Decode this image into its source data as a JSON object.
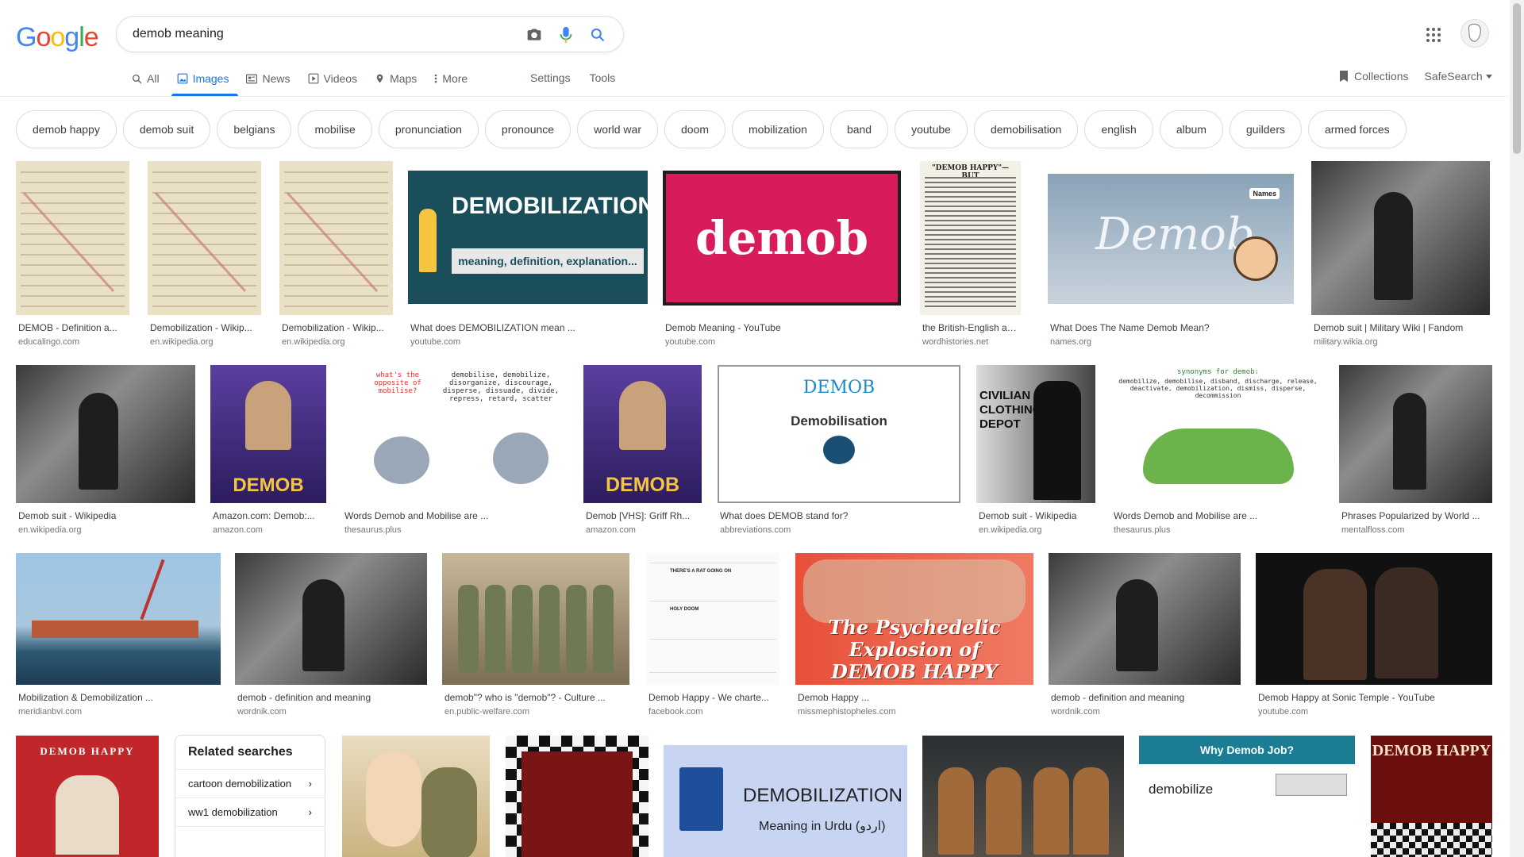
{
  "logo": {
    "letters": [
      "G",
      "o",
      "o",
      "g",
      "l",
      "e"
    ],
    "colors": [
      "#4285f4",
      "#ea4335",
      "#fbbc05",
      "#4285f4",
      "#34a853",
      "#ea4335"
    ]
  },
  "search": {
    "query": "demob meaning"
  },
  "tabs": [
    {
      "label": "All",
      "icon": "search-icon"
    },
    {
      "label": "Images",
      "icon": "image-icon",
      "active": true
    },
    {
      "label": "News",
      "icon": "news-icon"
    },
    {
      "label": "Videos",
      "icon": "video-icon"
    },
    {
      "label": "Maps",
      "icon": "map-icon"
    },
    {
      "label": "More",
      "icon": "more-vert-icon"
    }
  ],
  "tools": {
    "settings": "Settings",
    "tools": "Tools"
  },
  "right_tools": {
    "collections": "Collections",
    "safesearch": "SafeSearch"
  },
  "chips": [
    "demob happy",
    "demob suit",
    "belgians",
    "mobilise",
    "pronunciation",
    "pronounce",
    "world war",
    "doom",
    "mobilization",
    "band",
    "youtube",
    "demobilisation",
    "english",
    "album",
    "guilders",
    "armed forces"
  ],
  "results": [
    {
      "title": "DEMOB - Definition a...",
      "source": "educalingo.com"
    },
    {
      "title": "Demobilization - Wikip...",
      "source": "en.wikipedia.org"
    },
    {
      "title": "Demobilization - Wikip...",
      "source": "en.wikipedia.org"
    },
    {
      "title": "What does DEMOBILIZATION mean ...",
      "source": "youtube.com",
      "overlay": "DEMOBILIZATION",
      "sub": "meaning, definition, explanation..."
    },
    {
      "title": "Demob Meaning - YouTube",
      "source": "youtube.com",
      "overlay": "demob"
    },
    {
      "title": "the British-English adj...",
      "source": "wordhistories.net",
      "overlay": "\"DEMOB HAPPY\"—BUT"
    },
    {
      "title": "What Does The Name Demob Mean?",
      "source": "names.org",
      "overlay": "Demob",
      "sub": "Names"
    },
    {
      "title": "Demob suit | Military Wiki | Fandom",
      "source": "military.wikia.org"
    },
    {
      "title": "Demob suit - Wikipedia",
      "source": "en.wikipedia.org"
    },
    {
      "title": "Amazon.com: Demob:...",
      "source": "amazon.com",
      "overlay": "DEMOB"
    },
    {
      "title": "Words Demob and Mobilise are ...",
      "source": "thesaurus.plus",
      "overlay": "what's the opposite of mobilise?",
      "sub": "demobilise, demobilize, disorganize, discourage, disperse, dissuade, divide, repress, retard, scatter"
    },
    {
      "title": "Demob [VHS]: Griff Rh...",
      "source": "amazon.com",
      "overlay": "DEMOB"
    },
    {
      "title": "What does DEMOB stand for?",
      "source": "abbreviations.com",
      "overlay": "DEMOB",
      "sub": "Demobilisation"
    },
    {
      "title": "Demob suit - Wikipedia",
      "source": "en.wikipedia.org",
      "overlay": "CIVILIAN CLOTHING DEPOT"
    },
    {
      "title": "Words Demob and Mobilise are ...",
      "source": "thesaurus.plus",
      "overlay": "synonyms for demob:",
      "sub": "demobilize, demobilise, disband, discharge, release, deactivate, demobilization, dismiss, disperse, decommission"
    },
    {
      "title": "Phrases Popularized by World ...",
      "source": "mentalfloss.com"
    },
    {
      "title": "Mobilization & Demobilization ...",
      "source": "meridianbvi.com"
    },
    {
      "title": "demob - definition and meaning",
      "source": "wordnik.com"
    },
    {
      "title": "demob\"? who is \"demob\"? - Culture ...",
      "source": "en.public-welfare.com"
    },
    {
      "title": "Demob Happy - We charte...",
      "source": "facebook.com",
      "overlay": "THERE'S A RAT GOING ON",
      "sub": "HOLY DOOM"
    },
    {
      "title": "Demob Happy ...",
      "source": "missmephistopheles.com",
      "overlay": "The Psychedelic Explosion of DEMOB HAPPY"
    },
    {
      "title": "demob - definition and meaning",
      "source": "wordnik.com"
    },
    {
      "title": "Demob Happy at Sonic Temple - YouTube",
      "source": "youtube.com"
    },
    {
      "overlay": "DEMOB HAPPY"
    },
    {},
    {},
    {
      "overlay": "DEMOBILIZATION",
      "sub": "Meaning in Urdu (اردو)"
    },
    {},
    {
      "overlay": "Why Demob Job?",
      "sub": "demobilize"
    },
    {
      "overlay": "DEMOB HAPPY"
    }
  ],
  "related": {
    "heading": "Related searches",
    "items": [
      "cartoon demobilization",
      "ww1 demobilization"
    ]
  }
}
